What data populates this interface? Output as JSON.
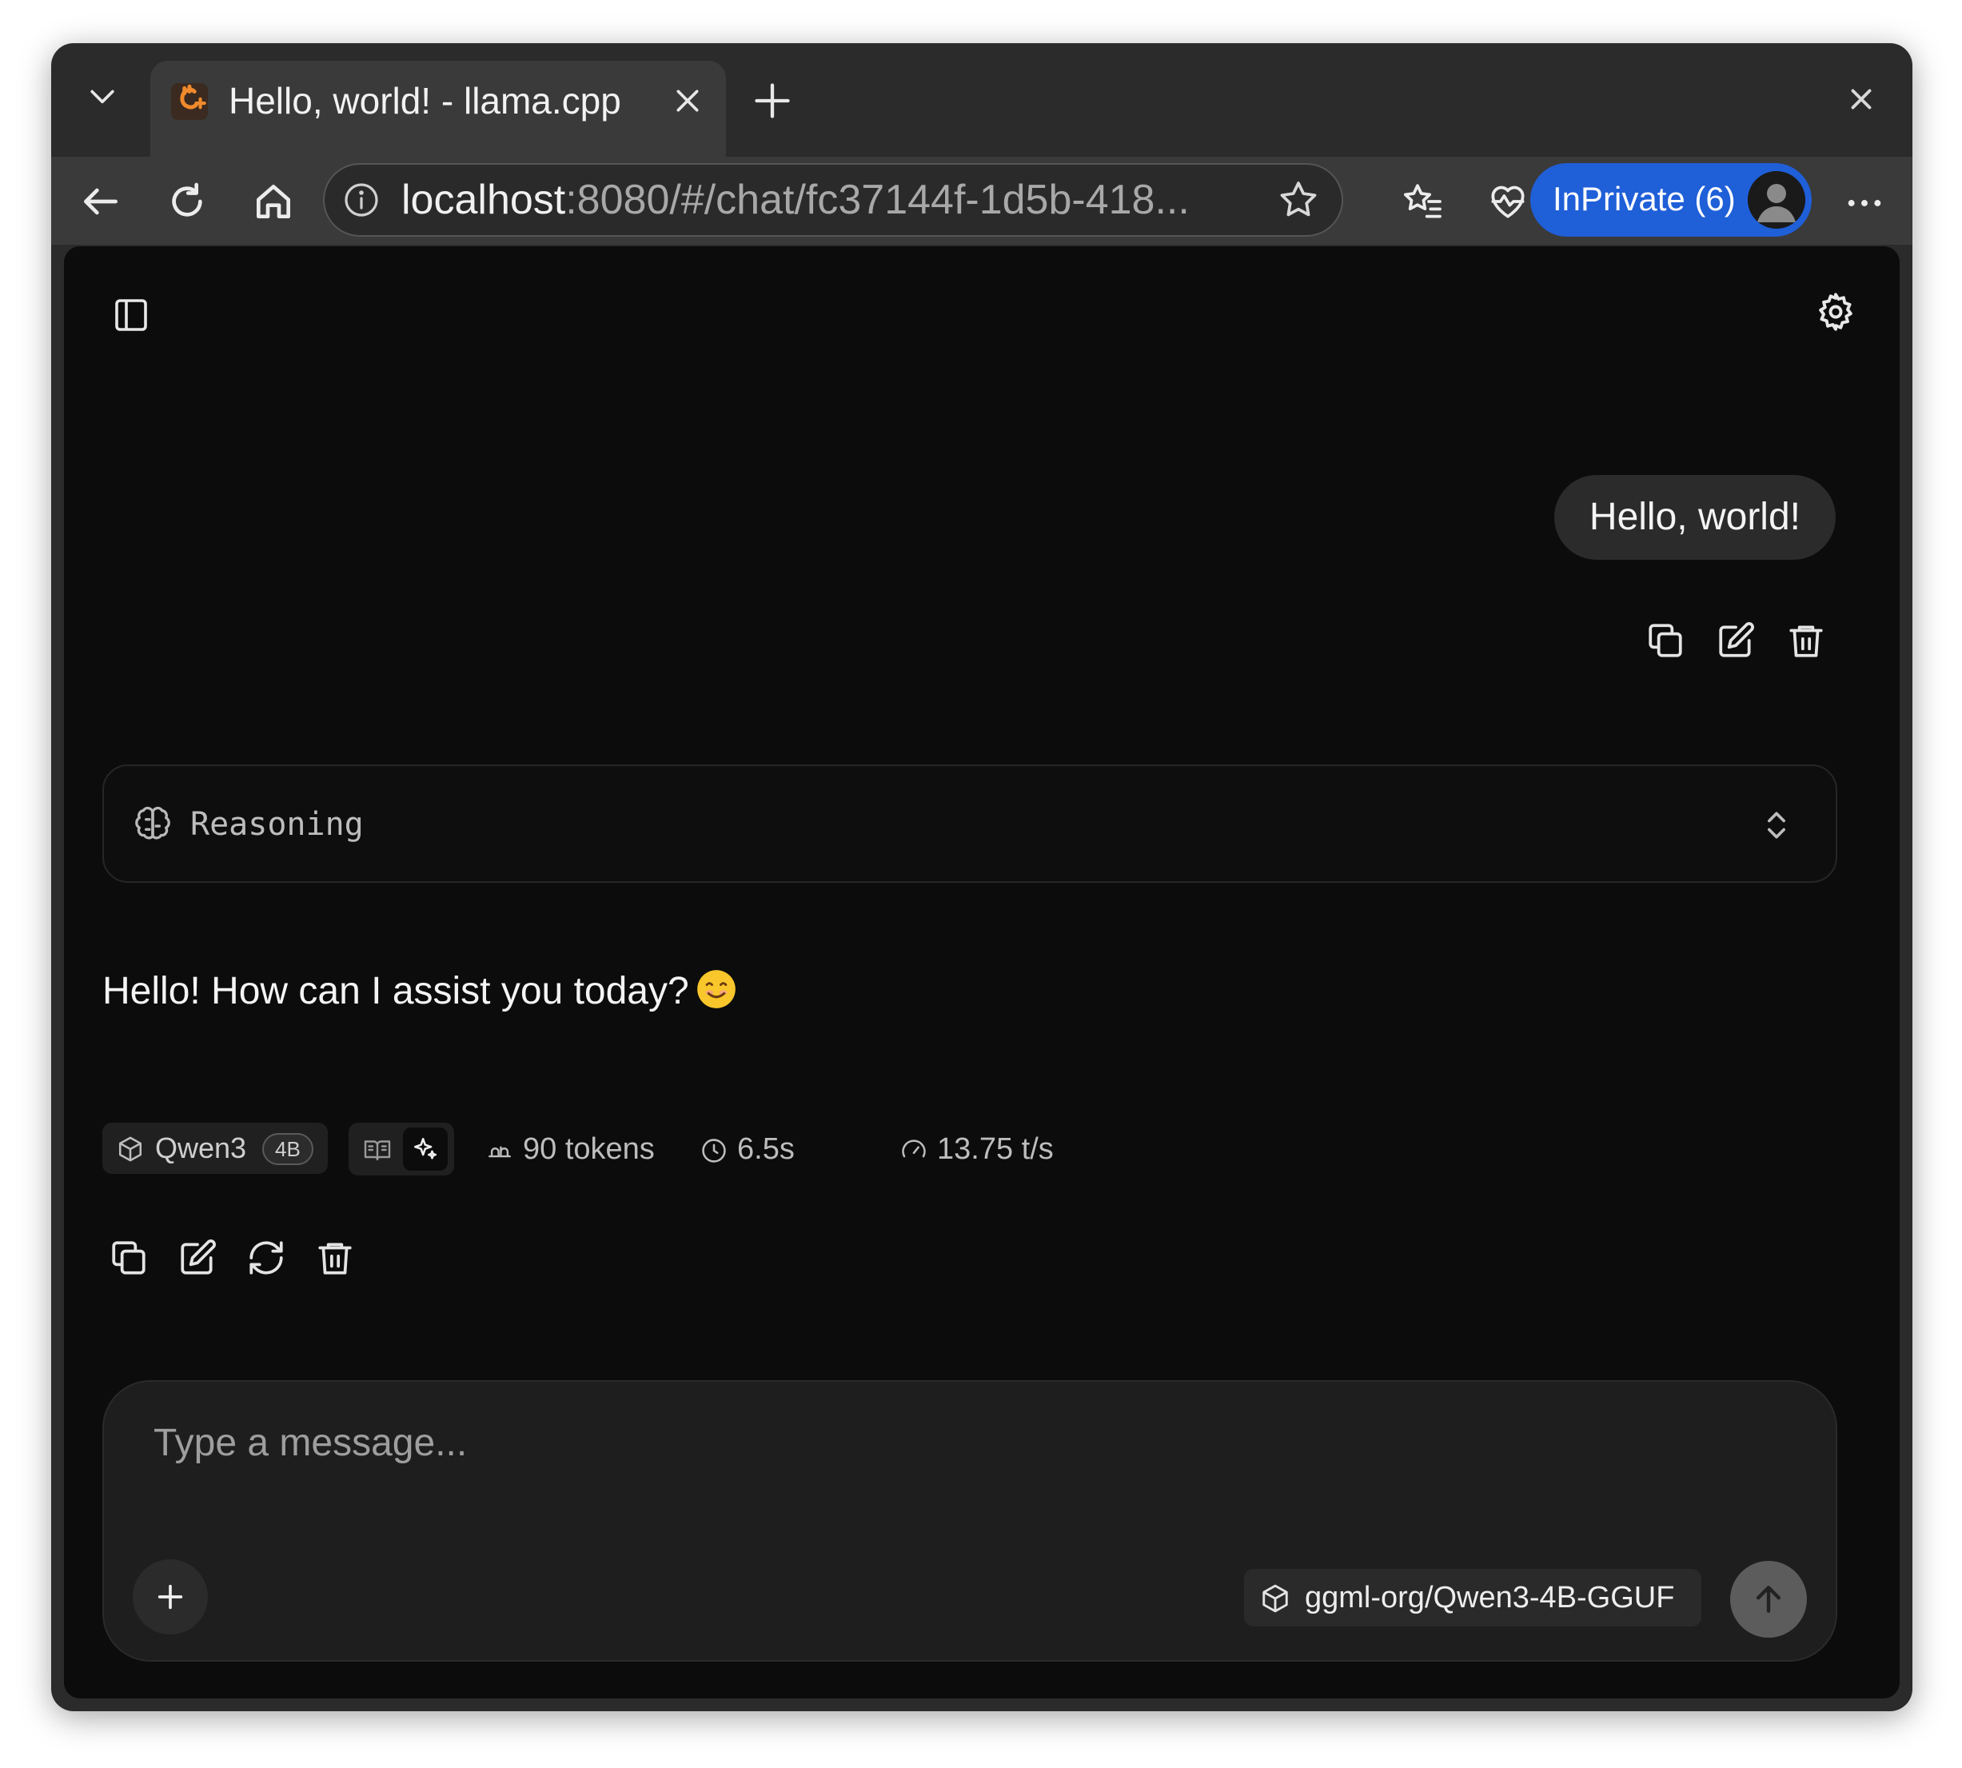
{
  "browser": {
    "tab": {
      "title": "Hello, world! - llama.cpp",
      "favicon": "llama-cpp-logo"
    },
    "address_bar": {
      "host": "localhost",
      "rest": ":8080/#/chat/fc37144f-1d5b-418..."
    },
    "profile": {
      "label": "InPrivate (6)",
      "accent": "#1f5fd8"
    }
  },
  "chat": {
    "user_message": "Hello, world!",
    "reasoning_label": "Reasoning",
    "assistant_message": "Hello! How can I assist you today?",
    "assistant_emoji": "smiling-face-emoji",
    "stats": {
      "model": "Qwen3",
      "model_size": "4B",
      "tokens": "90 tokens",
      "time": "6.5s",
      "speed": "13.75 t/s"
    }
  },
  "composer": {
    "placeholder": "Type a message...",
    "model": "ggml-org/Qwen3-4B-GGUF"
  },
  "colors": {
    "app_background": "#0c0c0c",
    "browser_frame": "#2b2b2b",
    "inprivate_blue": "#1f5fd8"
  }
}
